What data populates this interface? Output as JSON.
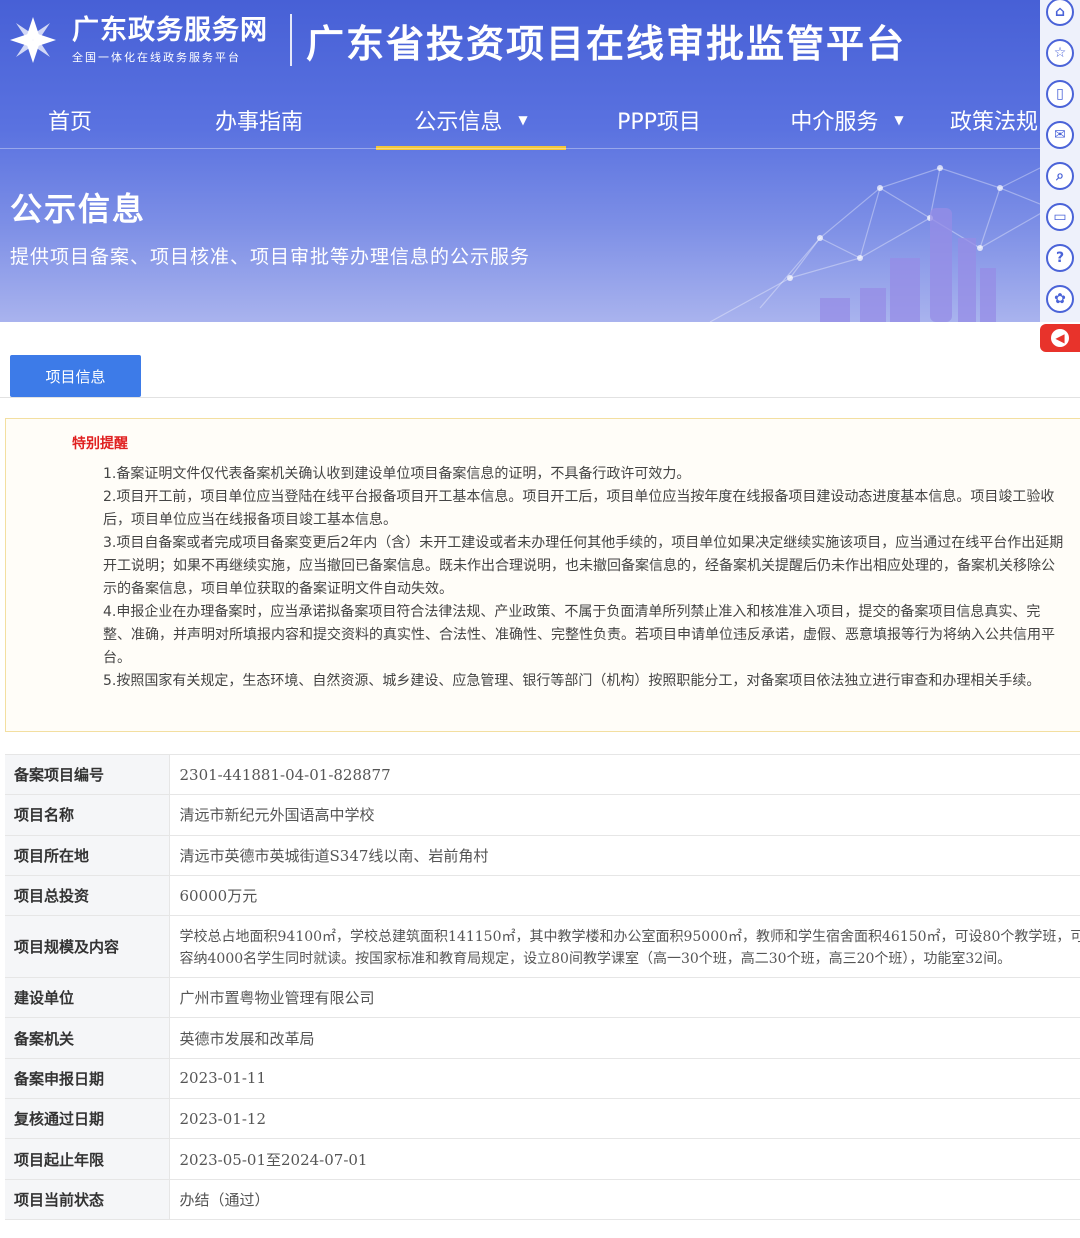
{
  "header": {
    "brand_name": "广东政务服务网",
    "brand_sub": "全国一体化在线政务服务平台",
    "platform_title": "广东省投资项目在线审批监管平台"
  },
  "nav": {
    "items": [
      {
        "label": "首页"
      },
      {
        "label": "办事指南"
      },
      {
        "label": "公示信息",
        "active": true,
        "dropdown": true
      },
      {
        "label": "PPP项目"
      },
      {
        "label": "中介服务",
        "dropdown": true
      },
      {
        "label": "政策法规"
      }
    ]
  },
  "section": {
    "title": "公示信息",
    "subtitle": "提供项目备案、项目核准、项目审批等办理信息的公示服务"
  },
  "side_tools": [
    "bank-icon",
    "star-icon",
    "mobile-icon",
    "chat-icon",
    "monitor-icon",
    "question-icon",
    "wechat-icon"
  ],
  "tab": {
    "label": "项目信息"
  },
  "notice": {
    "title": "特别提醒",
    "items": [
      "1.备案证明文件仅代表备案机关确认收到建设单位项目备案信息的证明，不具备行政许可效力。",
      "2.项目开工前，项目单位应当登陆在线平台报备项目开工基本信息。项目开工后，项目单位应当按年度在线报备项目建设动态进度基本信息。项目竣工验收后，项目单位应当在线报备项目竣工基本信息。",
      "3.项目自备案或者完成项目备案变更后2年内（含）未开工建设或者未办理任何其他手续的，项目单位如果决定继续实施该项目，应当通过在线平台作出延期开工说明；如果不再继续实施，应当撤回已备案信息。既未作出合理说明，也未撤回备案信息的，经备案机关提醒后仍未作出相应处理的，备案机关移除公示的备案信息，项目单位获取的备案证明文件自动失效。",
      "4.申报企业在办理备案时，应当承诺拟备案项目符合法律法规、产业政策、不属于负面清单所列禁止准入和核准准入项目，提交的备案项目信息真实、完整、准确，并声明对所填报内容和提交资料的真实性、合法性、准确性、完整性负责。若项目申请单位违反承诺，虚假、恶意填报等行为将纳入公共信用平台。",
      "5.按照国家有关规定，生态环境、自然资源、城乡建设、应急管理、银行等部门（机构）按照职能分工，对备案项目依法独立进行审查和办理相关手续。"
    ]
  },
  "project": {
    "rows": [
      {
        "label": "备案项目编号",
        "value": "2301-441881-04-01-828877"
      },
      {
        "label": "项目名称",
        "value": "清远市新纪元外国语高中学校"
      },
      {
        "label": "项目所在地",
        "value": "清远市英德市英城街道S347线以南、岩前角村"
      },
      {
        "label": "项目总投资",
        "value": "60000万元"
      },
      {
        "label": "项目规模及内容",
        "value": "学校总占地面积94100㎡，学校总建筑面积141150㎡，其中教学楼和办公室面积95000㎡，教师和学生宿舍面积46150㎡，可设80个教学班，可容纳4000名学生同时就读。按国家标准和教育局规定，设立80间教学课室（高一30个班，高二30个班，高三20个班），功能室32间。"
      },
      {
        "label": "建设单位",
        "value": "广州市置粤物业管理有限公司"
      },
      {
        "label": "备案机关",
        "value": "英德市发展和改革局"
      },
      {
        "label": "备案申报日期",
        "value": "2023-01-11"
      },
      {
        "label": "复核通过日期",
        "value": "2023-01-12"
      },
      {
        "label": "项目起止年限",
        "value": "2023-05-01至2024-07-01"
      },
      {
        "label": "项目当前状态",
        "value": "办结（通过）"
      }
    ]
  },
  "colors": {
    "banner_blue": "#4760d6",
    "nav_active_underline": "#f4c63a",
    "tab_blue": "#3d7be8",
    "notice_title_red": "#e02020",
    "back_button_red": "#e8332b"
  }
}
